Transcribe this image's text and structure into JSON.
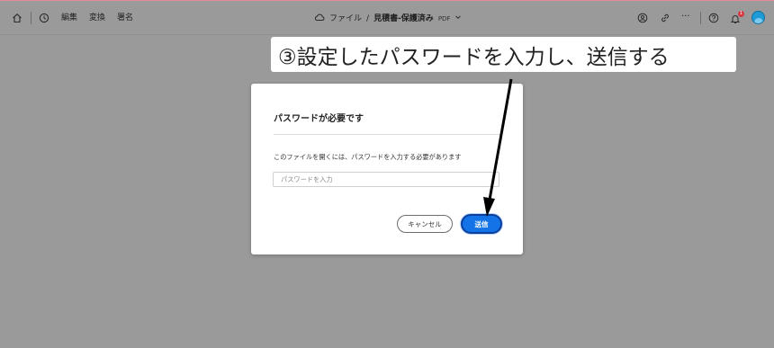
{
  "toolbar": {
    "icons": [
      "home-icon",
      "history-icon",
      "cloud-icon",
      "chevron-down-icon",
      "share-person-icon",
      "link-icon",
      "more-icon",
      "help-icon",
      "bell-icon"
    ],
    "menu": [
      {
        "label": "編集"
      },
      {
        "label": "変換"
      },
      {
        "label": "署名"
      }
    ],
    "breadcrumb": {
      "folder": "ファイル",
      "separator": "/",
      "file_name": "見積書-保護済み",
      "file_type": "PDF"
    },
    "notification_count": "1",
    "more_label": "···"
  },
  "dialog": {
    "title": "パスワードが必要です",
    "message": "このファイルを開くには、パスワードを入力する必要があります",
    "password_placeholder": "パスワードを入力",
    "password_value": "",
    "cancel_label": "キャンセル",
    "send_label": "送信"
  },
  "annotation": {
    "callout_text": "③設定したパスワードを入力し、送信する"
  },
  "colors": {
    "overlay_gray": "#9a9a9a",
    "primary_blue": "#1473e6",
    "focus_ring": "#0b3f9c",
    "badge_red": "#d7373f"
  }
}
